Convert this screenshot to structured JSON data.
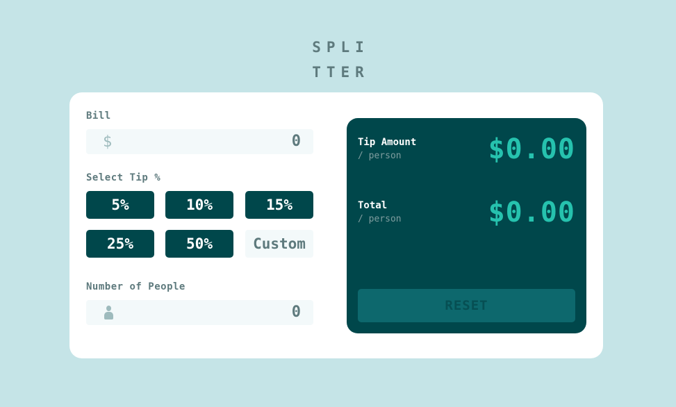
{
  "logo": {
    "line1": "SPLI",
    "line2": "TTER"
  },
  "bill": {
    "label": "Bill",
    "currency_symbol": "$",
    "value": "0"
  },
  "tip": {
    "label": "Select Tip %",
    "options": [
      "5%",
      "10%",
      "15%",
      "25%",
      "50%"
    ],
    "custom_placeholder": "Custom"
  },
  "people": {
    "label": "Number of People",
    "value": "0"
  },
  "results": {
    "tip_label": "Tip Amount",
    "tip_sub": "/ person",
    "tip_amount": "$0.00",
    "total_label": "Total",
    "total_sub": "/ person",
    "total_amount": "$0.00",
    "reset_label": "RESET"
  },
  "colors": {
    "background": "#c5e4e7",
    "card": "#ffffff",
    "dark_teal": "#00474b",
    "accent": "#26c2ae",
    "input_bg": "#f3f9fa",
    "reset_disabled": "#0d686d"
  }
}
